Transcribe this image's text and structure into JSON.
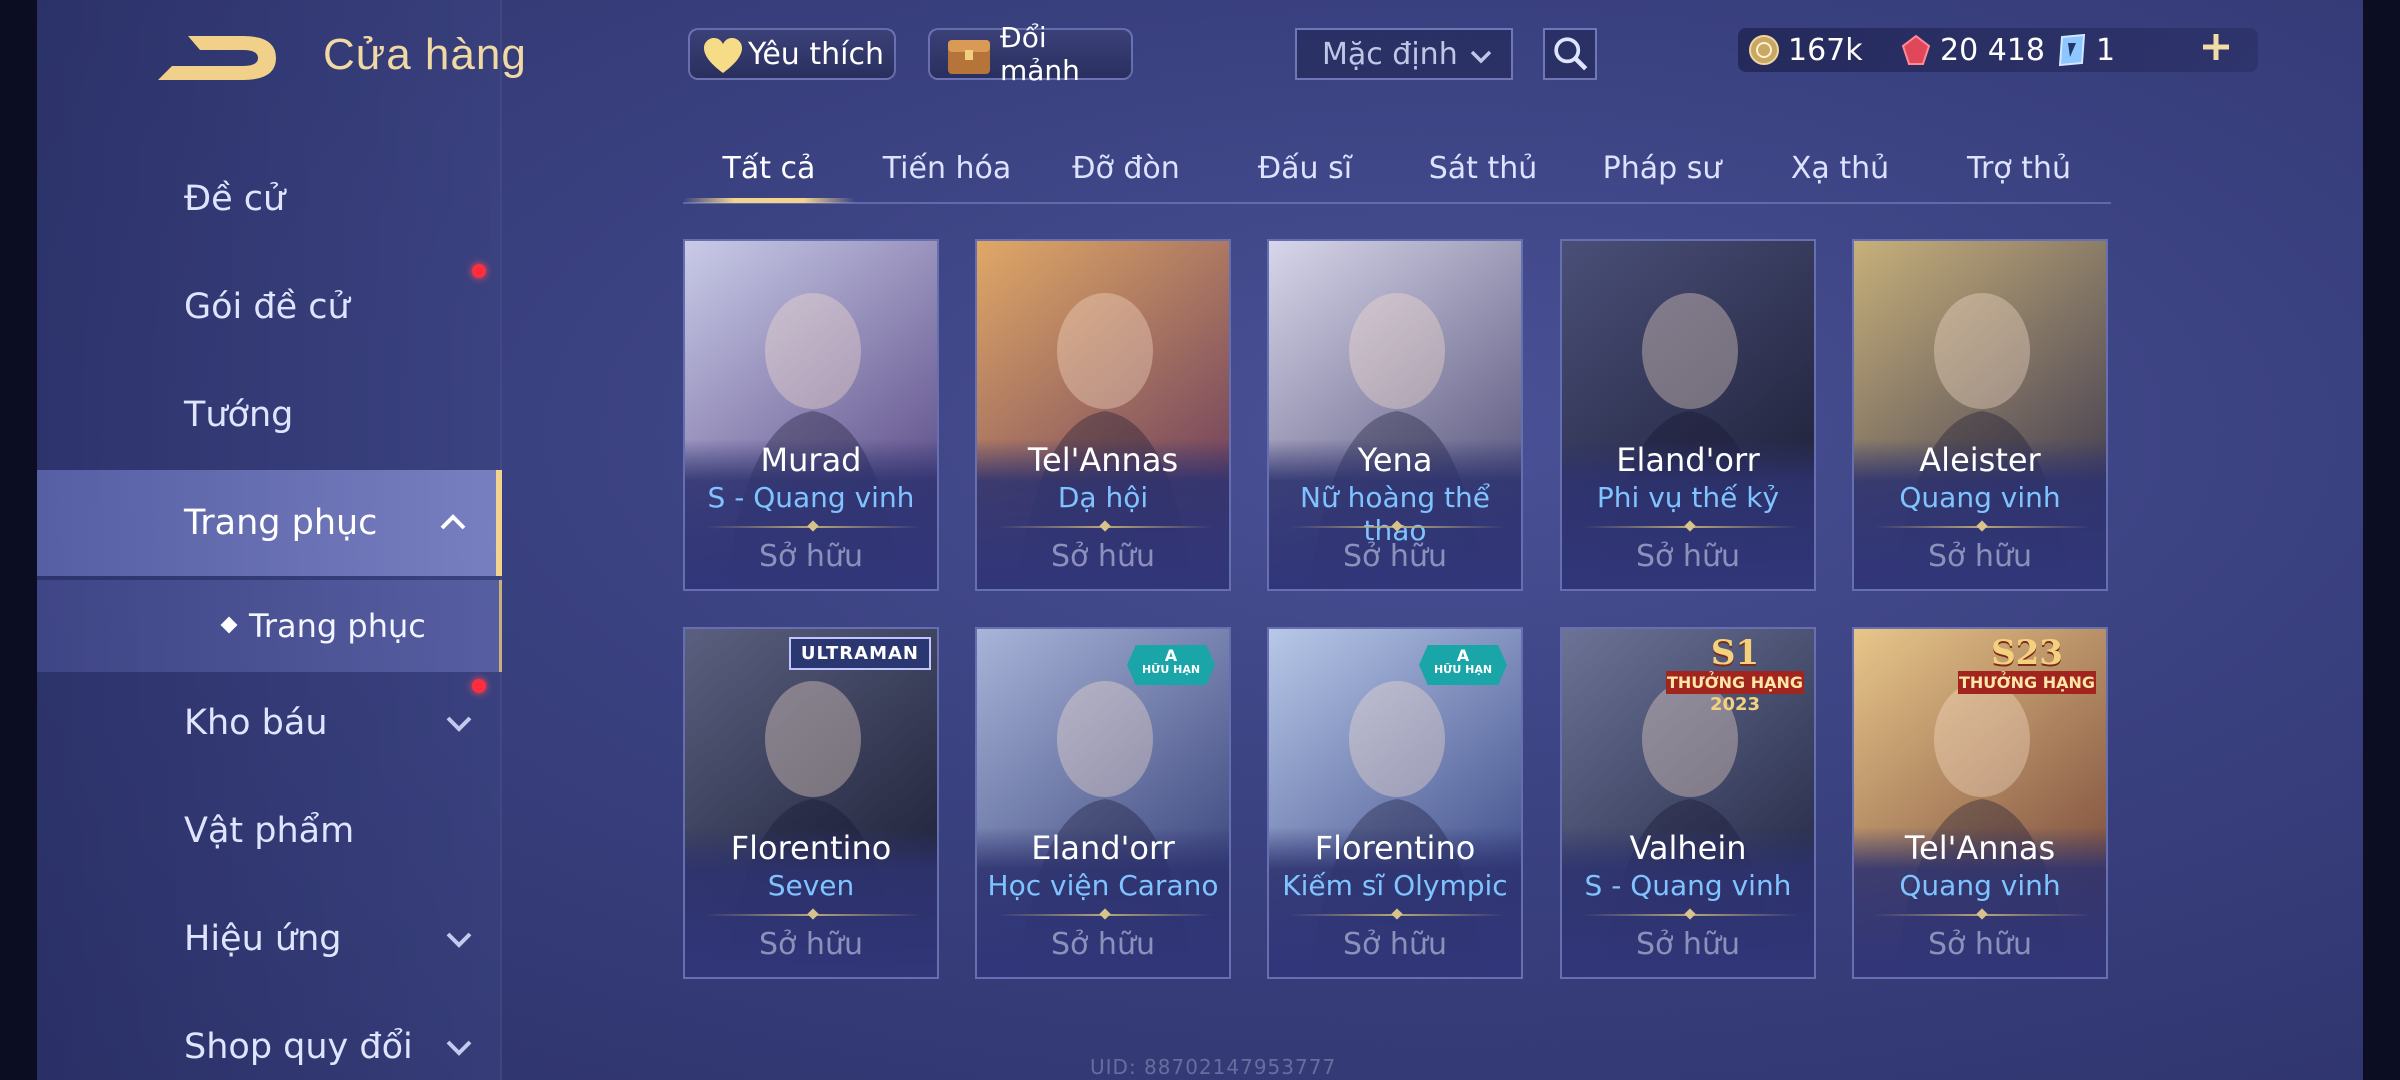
{
  "header": {
    "title": "Cửa hàng",
    "favorite_label": "Yêu thích",
    "shard_label": "Đổi mảnh",
    "sort_value": "Mặc định"
  },
  "currency": {
    "gold": "167k",
    "gems": "20 418",
    "vouchers": "1"
  },
  "sidebar": {
    "items": [
      {
        "label": "Đề cử"
      },
      {
        "label": "Gói đề cử"
      },
      {
        "label": "Tướng"
      },
      {
        "label": "Trang phục"
      },
      {
        "label": "Kho báu"
      },
      {
        "label": "Vật phẩm"
      },
      {
        "label": "Hiệu ứng"
      },
      {
        "label": "Shop quy đổi"
      }
    ],
    "sub_item": "Trang phục"
  },
  "tabs": [
    "Tất cả",
    "Tiến hóa",
    "Đỡ đòn",
    "Đấu sĩ",
    "Sát thủ",
    "Pháp sư",
    "Xạ thủ",
    "Trợ thủ"
  ],
  "cards": [
    {
      "hero": "Murad",
      "skin": "S - Quang vinh",
      "status": "Sở hữu",
      "palette": [
        "#c9cbe8",
        "#5b4a86"
      ]
    },
    {
      "hero": "Tel'Annas",
      "skin": "Dạ hội",
      "status": "Sở hữu",
      "palette": [
        "#e0a866",
        "#6b3c5c"
      ]
    },
    {
      "hero": "Yena",
      "skin": "Nữ hoàng thể thao",
      "status": "Sở hữu",
      "palette": [
        "#d8d6ea",
        "#55527a"
      ]
    },
    {
      "hero": "Eland'orr",
      "skin": "Phi vụ thế kỷ",
      "status": "Sở hữu",
      "palette": [
        "#4a4f78",
        "#1e2038"
      ]
    },
    {
      "hero": "Aleister",
      "skin": "Quang vinh",
      "status": "Sở hữu",
      "palette": [
        "#c7b07a",
        "#3f3a50"
      ]
    },
    {
      "hero": "Florentino",
      "skin": "Seven",
      "status": "Sở hữu",
      "palette": [
        "#5b6080",
        "#1c2036"
      ],
      "badge": "ULTRAMAN"
    },
    {
      "hero": "Eland'orr",
      "skin": "Học viện Carano",
      "status": "Sở hữu",
      "palette": [
        "#a8b4d8",
        "#37427a"
      ],
      "badge_limited": [
        "A",
        "HỮU HẠN"
      ]
    },
    {
      "hero": "Florentino",
      "skin": "Kiếm sĩ Olympic",
      "status": "Sở hữu",
      "palette": [
        "#b8c8e8",
        "#3c4a88"
      ],
      "badge_limited": [
        "A",
        "HỮU HẠN"
      ]
    },
    {
      "hero": "Valhein",
      "skin": "S - Quang vinh",
      "status": "Sở hữu",
      "palette": [
        "#6c7396",
        "#232845"
      ],
      "badge_season": [
        "S1",
        "THƯỞNG HẠNG",
        "2023"
      ]
    },
    {
      "hero": "Tel'Annas",
      "skin": "Quang vinh",
      "status": "Sở hữu",
      "palette": [
        "#e8c68a",
        "#7a4a3a"
      ],
      "badge_season": [
        "S23",
        "THƯỞNG HẠNG",
        ""
      ]
    }
  ],
  "footer": {
    "uid": "UID: 88702147953777"
  },
  "colors": {
    "accent_gold": "#f3d48f",
    "skin_name_blue": "#7fc3ff",
    "notification_red": "#ff2d3d"
  }
}
